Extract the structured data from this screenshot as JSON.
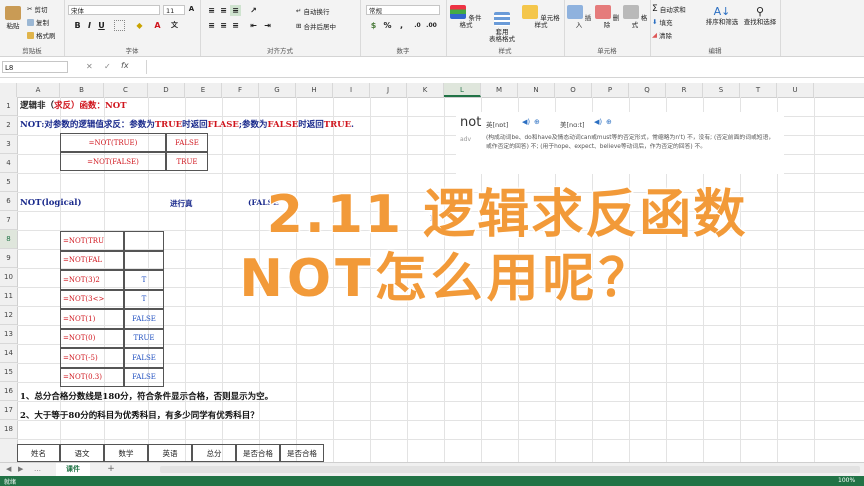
{
  "ribbon": {
    "clipboard": {
      "label": "剪贴板",
      "paste": "粘贴",
      "cut": "剪切",
      "copy": "复制",
      "format_painter": "格式刷"
    },
    "font": {
      "label": "字体",
      "name": "宋体",
      "size": "11"
    },
    "alignment": {
      "label": "对齐方式",
      "wrap": "自动换行",
      "merge": "合并后居中"
    },
    "number": {
      "label": "数字",
      "format": "常规"
    },
    "styles": {
      "label": "样式",
      "conditional": "条件格式",
      "table": "套用\n表格格式",
      "cell_styles": "单元格样式"
    },
    "cells": {
      "label": "单元格",
      "insert": "插入",
      "delete": "删除",
      "format": "格式"
    },
    "editing": {
      "label": "编辑",
      "autosum": "自动求和",
      "fill": "填充",
      "clear": "清除",
      "sort": "排序和筛选",
      "find": "查找和选择"
    }
  },
  "formula_bar": {
    "name_box": "L8",
    "fx": "fx",
    "value": ""
  },
  "columns": [
    "A",
    "B",
    "C",
    "D",
    "E",
    "F",
    "G",
    "H",
    "I",
    "J",
    "K",
    "L",
    "M",
    "N",
    "O",
    "P",
    "Q",
    "R",
    "S",
    "T",
    "U"
  ],
  "rows": [
    "1",
    "2",
    "3",
    "4",
    "5",
    "6",
    "7",
    "8",
    "9",
    "10",
    "11",
    "12",
    "13",
    "14",
    "15",
    "16",
    "17",
    "18"
  ],
  "sheet": {
    "r1": {
      "prefix": "逻辑非（",
      "mid": "求反",
      "suffix": "）函数：NOT"
    },
    "r2": {
      "a": "NOT:对参数的逻辑值求反：参数为",
      "b": "TRUE",
      "c": "时返回",
      "d": "FLASE",
      "e": ";参数为",
      "f": "FALSE",
      "g": "时返回",
      "h": "TRUE",
      "i": "."
    },
    "top_table": [
      {
        "formula": "=NOT(TRUE)",
        "result": "FALSE"
      },
      {
        "formula": "=NOT(FALSE)",
        "result": "TRUE"
      }
    ],
    "r6": {
      "a": "NOT(logical)",
      "b": "进行真",
      "c": "(FALSE",
      "d": "E,"
    },
    "main_table": [
      {
        "formula": "=NOT(TRU",
        "result": ""
      },
      {
        "formula": "=NOT(FAL",
        "result": ""
      },
      {
        "formula": "=NOT(3)2",
        "result": "T"
      },
      {
        "formula": "=NOT(3<>",
        "result": "T"
      },
      {
        "formula": "=NOT(1)",
        "result": "FALSE"
      },
      {
        "formula": "=NOT(0)",
        "result": "TRUE"
      },
      {
        "formula": "=NOT(-5)",
        "result": "FALSE"
      },
      {
        "formula": "=NOT(0.3)",
        "result": "FALSE"
      }
    ],
    "q1": "1、总分合格分数线是180分，符合条件显示合格，否则显示为空。",
    "q2": "2、大于等于80分的科目为优秀科目，有多少同学有优秀科目？",
    "header_row": [
      "姓名",
      "语文",
      "数学",
      "英语",
      "总分",
      "是否合格",
      "是否合格"
    ]
  },
  "dictionary": {
    "word": "not",
    "uk": "英[nɒt]",
    "us": "美[nɑ:t]",
    "pos": "adv",
    "definition": "(构成动词be、do和have及情态动词can或must等的否定形式，常缩略为n't) 不，没有; (否定前面的词或短语，或作否定的回答) 不; (用于hope、expect、believe等动词后，作为否定的回答) 不。"
  },
  "overlay": {
    "line1": "2.11 逻辑求反函数",
    "line2": "NOT怎么用呢？"
  },
  "sheet_tabs": {
    "active": "课件",
    "add": "+"
  },
  "status": {
    "ready": "就绪",
    "zoom": "100%"
  },
  "colors": {
    "accent": "#217346",
    "overlay": "#f29a39",
    "red": "#d0161e",
    "blue": "#1f4fc0"
  }
}
